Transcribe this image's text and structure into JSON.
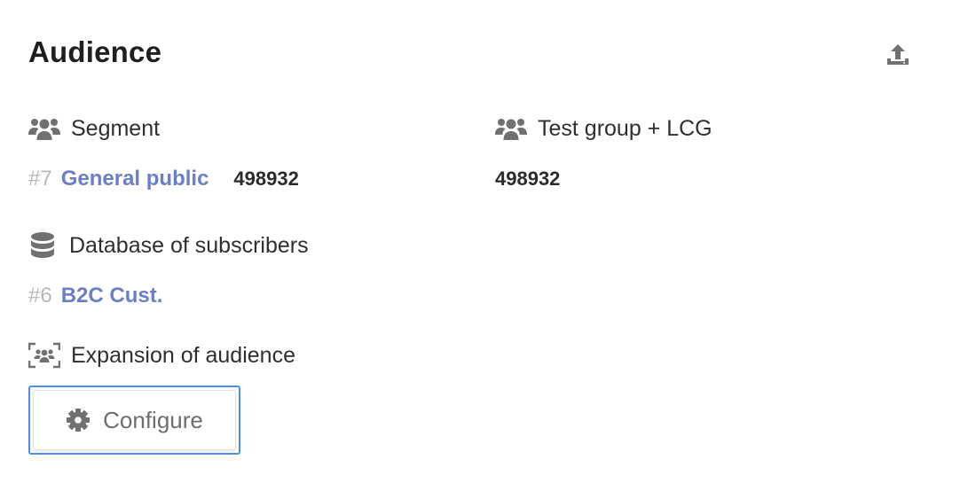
{
  "header": {
    "title": "Audience",
    "export_icon": "upload-icon"
  },
  "segment": {
    "label": "Segment",
    "icon": "users-icon",
    "id": "#7",
    "name": "General public",
    "count": "498932"
  },
  "test_group": {
    "label": "Test group + LCG",
    "icon": "users-icon",
    "count": "498932"
  },
  "database": {
    "label": "Database of subscribers",
    "icon": "database-icon",
    "id": "#6",
    "name": "B2C Cust."
  },
  "expansion": {
    "label": "Expansion of audience",
    "icon": "audience-expand-icon",
    "button_label": "Configure",
    "button_icon": "gear-icon"
  },
  "colors": {
    "link": "#6a7fc9",
    "focus_border": "#4a8ff0",
    "icon": "#707070",
    "muted": "#b8b8b8"
  }
}
